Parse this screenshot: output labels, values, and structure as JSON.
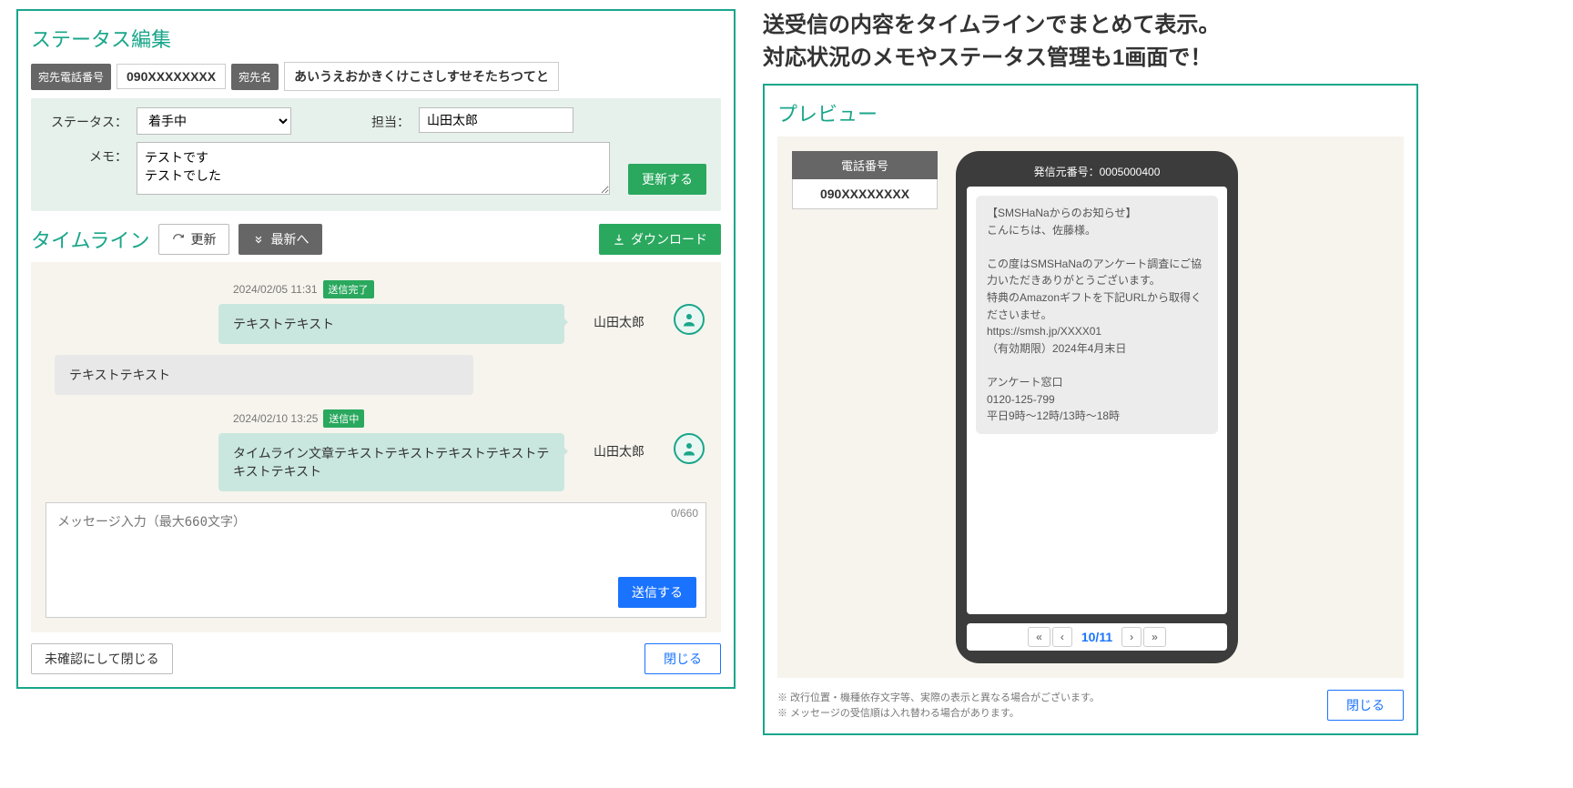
{
  "caption_line1": "送受信の内容をタイムラインでまとめて表示。",
  "caption_line2": "対応状況のメモやステータス管理も1画面で！",
  "status_panel": {
    "title": "ステータス編集",
    "tel_label": "宛先電話番号",
    "tel_value": "090XXXXXXXX",
    "name_label": "宛先名",
    "name_value": "あいうえおかきくけこさしすせそたちつてと",
    "status_label": "ステータス：",
    "status_value": "着手中",
    "assignee_label": "担当：",
    "assignee_value": "山田太郎",
    "memo_label": "メモ：",
    "memo_value": "テストです\nテストでした",
    "update_btn": "更新する"
  },
  "timeline": {
    "title": "タイムライン",
    "refresh_btn": "更新",
    "latest_btn": "最新へ",
    "download_btn": "ダウンロード",
    "entries": [
      {
        "time": "2024/02/05 11:31",
        "badge": "送信完了",
        "text": "テキストテキスト",
        "sender": "山田太郎"
      },
      {
        "note": "テキストテキスト"
      },
      {
        "time": "2024/02/10 13:25",
        "badge": "送信中",
        "text": "タイムライン文章テキストテキストテキストテキストテキストテキスト",
        "sender": "山田太郎"
      }
    ],
    "composer_placeholder": "メッセージ入力（最大660文字）",
    "counter": "0/660",
    "send_btn": "送信する",
    "unconfirm_btn": "未確認にして閉じる",
    "close_btn": "閉じる"
  },
  "preview": {
    "title": "プレビュー",
    "phone_label": "電話番号",
    "phone_number": "090XXXXXXXX",
    "caller_label": "発信元番号：0005000400",
    "sms_body": "【SMSHaNaからのお知らせ】\nこんにちは、佐藤様。\n\nこの度はSMSHaNaのアンケート調査にご協力いただきありがとうございます。\n特典のAmazonギフトを下記URLから取得くださいませ。\nhttps://smsh.jp/XXXX01\n（有効期限）2024年4月末日\n\nアンケート窓口\n0120-125-799\n平日9時～12時/13時～18時",
    "pager": {
      "first": "«",
      "prev": "‹",
      "current": "10/11",
      "next": "›",
      "last": "»"
    },
    "foot1": "※ 改行位置・機種依存文字等、実際の表示と異なる場合がございます。",
    "foot2": "※ メッセージの受信順は入れ替わる場合があります。",
    "close_btn": "閉じる"
  }
}
